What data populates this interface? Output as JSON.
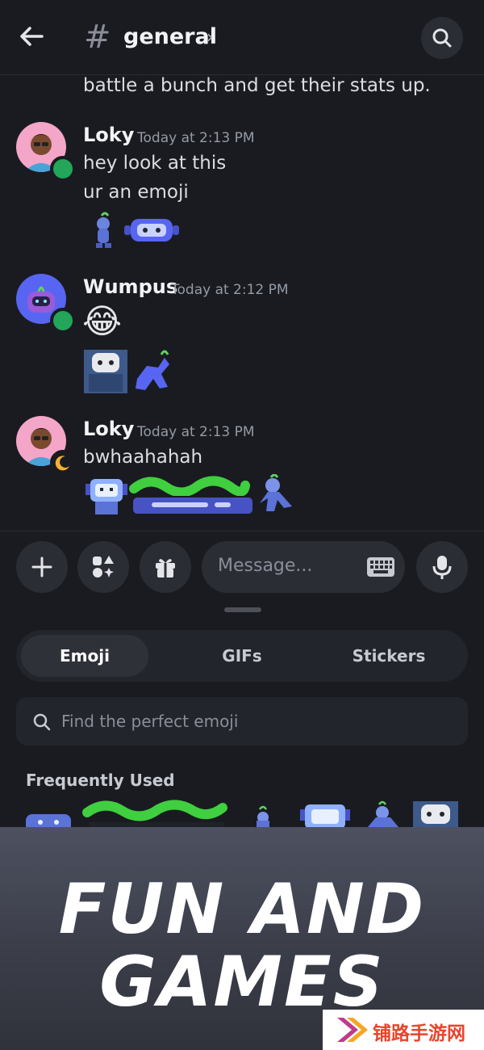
{
  "header": {
    "channel_name": "general",
    "hash_symbol": "#",
    "chevron": "›"
  },
  "messages": {
    "continuation_text": "battle a bunch and get their stats up.",
    "items": [
      {
        "author": "Loky",
        "time": "Today at 2:13 PM",
        "lines": [
          "hey look at this",
          "ur an emoji"
        ],
        "status": "online"
      },
      {
        "author": "Wumpus",
        "time": "Today at 2:12 PM",
        "emoji": "😂",
        "status": "online"
      },
      {
        "author": "Loky",
        "time": "Today at 2:13 PM",
        "lines": [
          "bwhaahahah"
        ],
        "status": "idle"
      }
    ]
  },
  "composer": {
    "placeholder": "Message..."
  },
  "picker": {
    "tabs": [
      "Emoji",
      "GIFs",
      "Stickers"
    ],
    "search_placeholder": "Find the perfect emoji",
    "section_label": "Frequently Used"
  },
  "promo": {
    "line1": "FUN AND",
    "line2": "GAMES"
  },
  "watermark": {
    "text": "铺路手游网"
  },
  "colors": {
    "background": "#1a1b21",
    "online": "#23a55a",
    "blurple": "#5865f2"
  }
}
